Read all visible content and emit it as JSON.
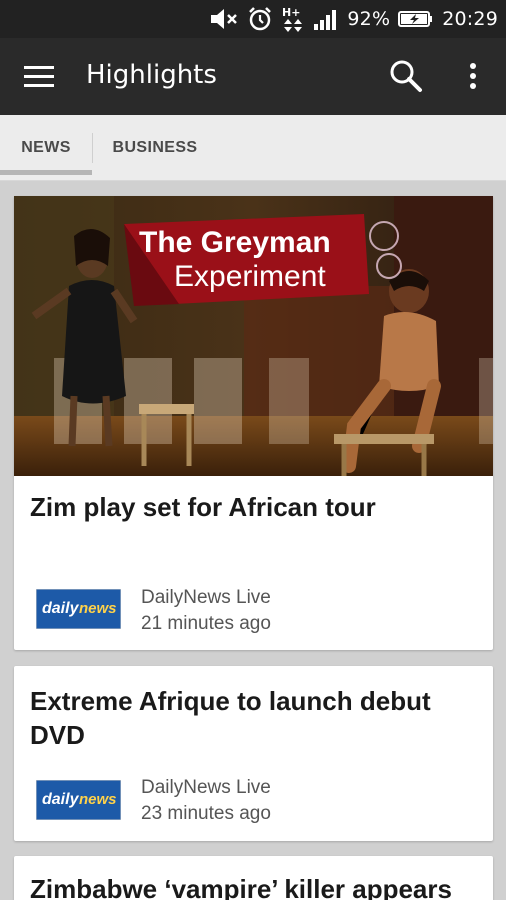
{
  "status_bar": {
    "battery": "92%",
    "time": "20:29",
    "icons": [
      "mute-icon",
      "alarm-icon",
      "data-transfer-icon",
      "signal-icon",
      "battery-icon"
    ]
  },
  "toolbar": {
    "title": "Highlights",
    "icons": [
      "menu-icon",
      "search-icon",
      "overflow-icon"
    ]
  },
  "tabs": [
    {
      "label": "NEWS",
      "selected": true
    },
    {
      "label": "BUSINESS",
      "selected": false
    }
  ],
  "articles": [
    {
      "headline": "Zim play set for African tour",
      "image_caption": "The Greyman Experiment",
      "source": "DailyNews Live",
      "time": "21 minutes ago",
      "logo_text": "dailynews"
    },
    {
      "headline": "Extreme Afrique to launch debut DVD",
      "source": "DailyNews Live",
      "time": "23 minutes ago",
      "logo_text": "dailynews"
    },
    {
      "headline": "Zimbabwe ‘vampire’ killer appears"
    }
  ],
  "colors": {
    "toolbar": "#2a2a2a",
    "status_bar": "#222222",
    "tabs_bg": "#ececec",
    "page_bg": "#d0d0d0",
    "logo_blue": "#1d5aa8"
  }
}
